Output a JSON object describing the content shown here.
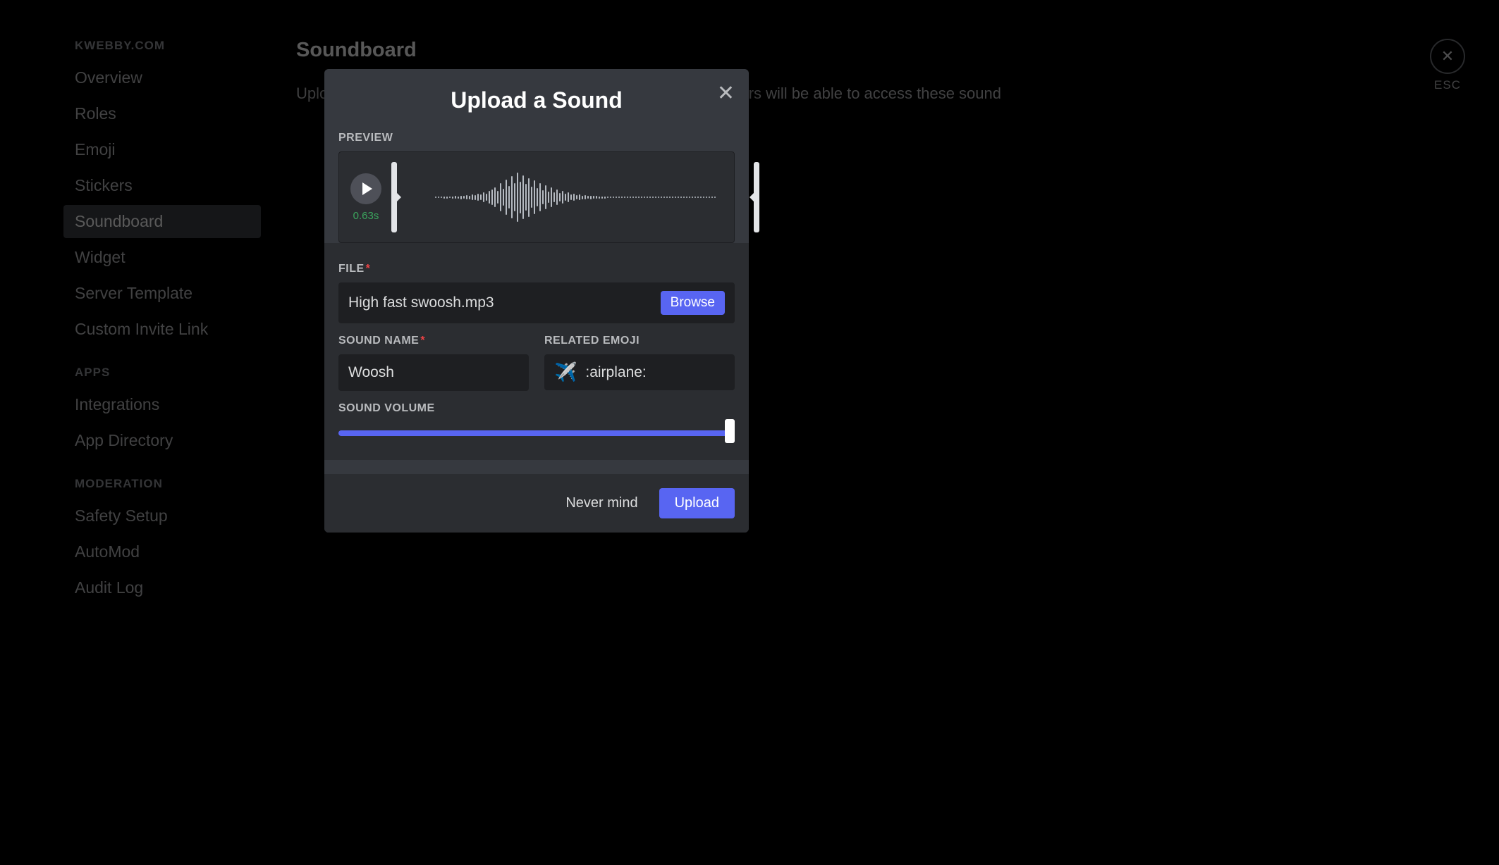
{
  "sidebar": {
    "server_name": "KWEBBY.COM",
    "section_main_items": [
      {
        "label": "Overview",
        "active": false
      },
      {
        "label": "Roles",
        "active": false
      },
      {
        "label": "Emoji",
        "active": false
      },
      {
        "label": "Stickers",
        "active": false
      },
      {
        "label": "Soundboard",
        "active": true
      },
      {
        "label": "Widget",
        "active": false
      },
      {
        "label": "Server Template",
        "active": false
      },
      {
        "label": "Custom Invite Link",
        "active": false
      }
    ],
    "apps_title": "APPS",
    "apps_items": [
      {
        "label": "Integrations"
      },
      {
        "label": "App Directory"
      }
    ],
    "moderation_title": "MODERATION",
    "moderation_items": [
      {
        "label": "Safety Setup"
      },
      {
        "label": "AutoMod"
      },
      {
        "label": "Audit Log"
      }
    ]
  },
  "page": {
    "title": "Soundboard",
    "description_partial_left": "Uploa",
    "description_partial_right": "rs will be able to access these sound"
  },
  "esc": {
    "label": "ESC"
  },
  "modal": {
    "title": "Upload a Sound",
    "preview_label": "PREVIEW",
    "play_time": "0.63s",
    "file_label": "FILE",
    "file_name": "High fast swoosh.mp3",
    "browse_label": "Browse",
    "sound_name_label": "SOUND NAME",
    "sound_name_value": "Woosh",
    "related_emoji_label": "RELATED EMOJI",
    "emoji_glyph": "✈️",
    "emoji_code": ":airplane:",
    "volume_label": "SOUND VOLUME",
    "volume_percent": 100,
    "never_mind_label": "Never mind",
    "upload_label": "Upload"
  }
}
